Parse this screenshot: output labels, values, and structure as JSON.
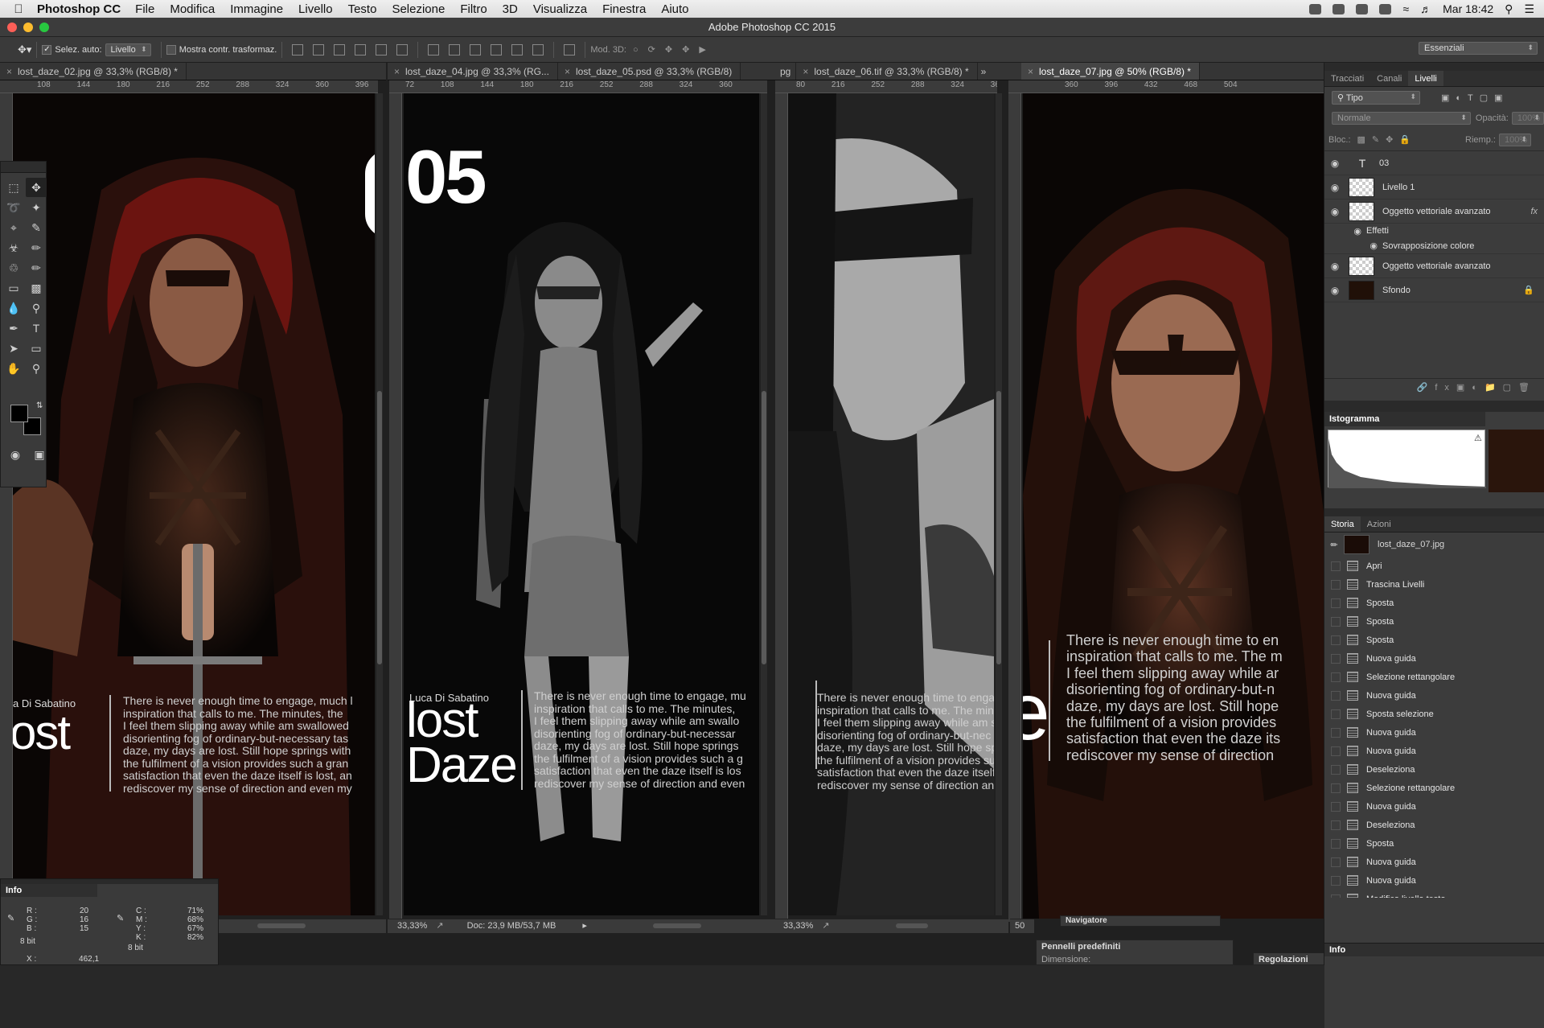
{
  "menubar": {
    "app": "Photoshop CC",
    "items": [
      "File",
      "Modifica",
      "Immagine",
      "Livello",
      "Testo",
      "Selezione",
      "Filtro",
      "3D",
      "Visualizza",
      "Finestra",
      "Aiuto"
    ],
    "clock": "Mar 18:42"
  },
  "window": {
    "title": "Adobe Photoshop CC 2015"
  },
  "options": {
    "auto_select_label": "Selez. auto:",
    "auto_select_value": "Livello",
    "show_transform_label": "Mostra contr. trasformaz.",
    "mode3d_label": "Mod. 3D:",
    "workspace": "Essenziali"
  },
  "docs": [
    {
      "tab": "lost_daze_02.jpg @ 33,3% (RGB/8) *",
      "ruler": [
        "108",
        "144",
        "180",
        "216",
        "252",
        "288",
        "324",
        "360",
        "396"
      ]
    },
    {
      "tab": "lost_daze_04.jpg @ 33,3% (RG...",
      "ruler": [
        "72",
        "108",
        "144",
        "180",
        "216",
        "252",
        "288",
        "324",
        "360"
      ]
    },
    {
      "tab": "lost_daze_05.psd @ 33,3% (RGB/8)",
      "ruler": []
    },
    {
      "tab": "lost_daze_06.tif @ 33,3% (RGB/8) *",
      "ruler": [
        "80",
        "216",
        "252",
        "288",
        "324",
        "360",
        "396",
        "432"
      ]
    },
    {
      "tab": "lost_daze_07.jpg @ 50% (RGB/8) *",
      "ruler": [
        "360",
        "396",
        "432",
        "468",
        "504"
      ]
    }
  ],
  "tab_fragment": "pg",
  "tab_overflow": "»",
  "artwork": {
    "number": "05",
    "author": "Luca Di Sabatino",
    "author_partial": "a Di Sabatino",
    "title_line1": "lost",
    "title_line2": "Daze",
    "title_partial": "ost",
    "letter_partial": "e",
    "body_doc2": "There is never enough time to engage, much l\ninspiration that calls to me. The minutes, the\nI feel them slipping away while am swallowed\ndisorienting fog of ordinary-but-necessary tas\ndaze, my days are lost. Still hope springs with\nthe fulfilment of a vision provides such a gran\nsatisfaction that even the daze itself is lost, an\nrediscover my sense of direction and even my",
    "body_doc4": "There is never enough time to engage, mu\ninspiration that calls to me. The minutes,\nI feel them slipping away while am swallo\ndisorienting fog of ordinary-but-necessar\ndaze, my days are lost. Still hope springs\nthe fulfilment of a vision provides such a g\nsatisfaction that even the daze itself is los\nrediscover my sense of direction and even",
    "body_doc6": "There is never enough time to engag\ninspiration that calls to me. The min\nI feel them slipping away while am s\ndisorienting fog of ordinary-but-nec\ndaze, my days are lost. Still hope sp\nthe fulfilment of a vision provides su\nsatisfaction that even the daze itself\nrediscover my sense of direction and",
    "body_doc7": "There is never enough time to en\ninspiration that calls to me. The m\nI feel them slipping away while ar\ndisorienting fog of ordinary-but-n\ndaze, my days are lost. Still hope\nthe fulfilment of a vision provides\nsatisfaction that even the daze its\nrediscover my sense of direction"
  },
  "status": [
    {
      "zoom": "33,33%",
      "doc": "Doc: 23,9 MB/53,7 MB"
    },
    {
      "zoom": "33,33%",
      "doc": ""
    },
    {
      "zoom": "50",
      "doc": ""
    }
  ],
  "layers_panel": {
    "tabs": [
      "Tracciati",
      "Canali",
      "Livelli"
    ],
    "filter": "Tipo",
    "blend": "Normale",
    "opacity_label": "Opacità:",
    "opacity": "100%",
    "lock_label": "Bloc.:",
    "fill_label": "Riemp.:",
    "fill": "100%",
    "layers": [
      {
        "name": "03",
        "kind": "text"
      },
      {
        "name": "Livello 1",
        "kind": "pixel"
      },
      {
        "name": "Oggetto vettoriale avanzato",
        "kind": "smart",
        "fx": "fx"
      },
      {
        "name": "Effetti",
        "kind": "effects"
      },
      {
        "name": "Sovrapposizione colore",
        "kind": "effect"
      },
      {
        "name": "Oggetto vettoriale avanzato",
        "kind": "smart"
      },
      {
        "name": "Sfondo",
        "kind": "background"
      }
    ]
  },
  "histogram": {
    "title": "Istogramma"
  },
  "history_panel": {
    "tabs": [
      "Storia",
      "Azioni"
    ],
    "snapshot": "lost_daze_07.jpg",
    "items": [
      "Apri",
      "Trascina Livelli",
      "Sposta",
      "Sposta",
      "Sposta",
      "Nuova guida",
      "Selezione rettangolare",
      "Nuova guida",
      "Sposta selezione",
      "Nuova guida",
      "Nuova guida",
      "Deseleziona",
      "Selezione rettangolare",
      "Nuova guida",
      "Deseleziona",
      "Sposta",
      "Nuova guida",
      "Nuova guida",
      "Modifica livello testo"
    ]
  },
  "info_panel": {
    "title": "Info",
    "r": "20",
    "g": "16",
    "b": "15",
    "c": "71%",
    "m": "68%",
    "y": "67%",
    "k": "82%",
    "bits": "8 bit",
    "x_label": "X :",
    "x": "462,1"
  },
  "bottom_panels": {
    "navigator": "Navigatore",
    "brushes": "Pennelli predefiniti",
    "brush_size": "Dimensione:",
    "adjustments": "Regolazioni"
  },
  "colors": {
    "ps_dark": "#282828",
    "panel": "#3c3c3c",
    "hood_red": "#6b1410"
  }
}
